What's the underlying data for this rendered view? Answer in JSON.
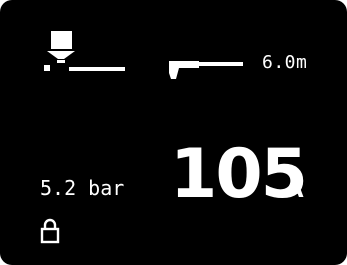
{
  "display": {
    "background_color": "#000000",
    "foreground_color": "#ffffff",
    "torch_height": {
      "icon": "torch-on-plate-icon"
    },
    "cable": {
      "icon": "torch-cable-icon",
      "length": "6.0m"
    },
    "air_pressure": {
      "value": "5.2 bar"
    },
    "cutting_current": {
      "value": "105",
      "unit": "A"
    },
    "lock": {
      "icon": "lock-icon"
    }
  }
}
